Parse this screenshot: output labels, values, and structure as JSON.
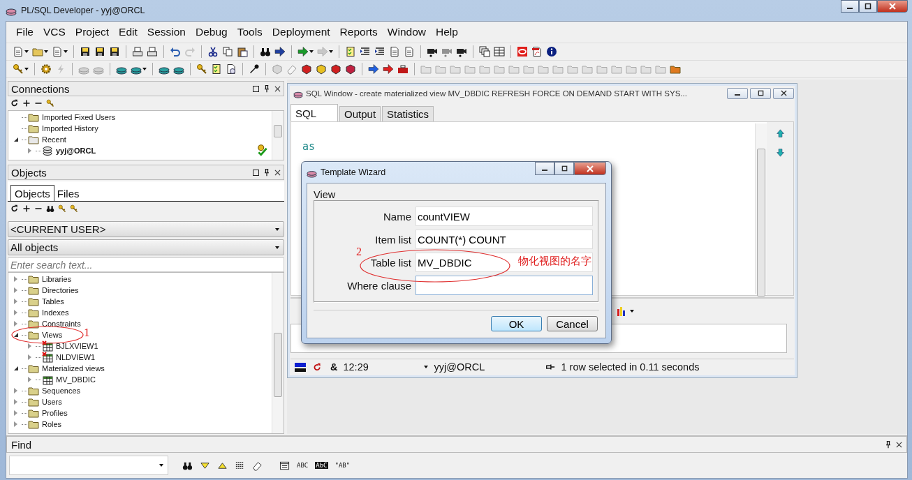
{
  "window": {
    "title": "PL/SQL Developer - yyj@ORCL"
  },
  "menu": [
    "File",
    "VCS",
    "Project",
    "Edit",
    "Session",
    "Debug",
    "Tools",
    "Deployment",
    "Reports",
    "Window",
    "Help"
  ],
  "connections": {
    "title": "Connections",
    "tree": [
      {
        "label": "Imported Fixed Users"
      },
      {
        "label": "Imported History"
      },
      {
        "label": "Recent",
        "expanded": true,
        "children": [
          {
            "label": "yyj@ORCL",
            "current": true
          }
        ]
      }
    ]
  },
  "objects": {
    "title": "Objects",
    "tabs": [
      {
        "label": "Objects",
        "selected": true
      },
      {
        "label": "Files",
        "selected": false
      }
    ],
    "owner": "<CURRENT USER>",
    "filter": "All objects",
    "search": {
      "placeholder": "Enter search text..."
    },
    "tree": [
      {
        "label": "Libraries",
        "expanded": false
      },
      {
        "label": "Directories",
        "expanded": false
      },
      {
        "label": "Tables",
        "expanded": false
      },
      {
        "label": "Indexes",
        "expanded": false
      },
      {
        "label": "Constraints",
        "expanded": false
      },
      {
        "label": "Views",
        "expanded": true,
        "children": [
          {
            "label": "BJLXVIEW1",
            "invalid": true
          },
          {
            "label": "NLDVIEW1",
            "invalid": true
          }
        ]
      },
      {
        "label": "Materialized views",
        "expanded": true,
        "children": [
          {
            "label": "MV_DBDIC",
            "invalid": false
          }
        ]
      },
      {
        "label": "Sequences",
        "expanded": false
      },
      {
        "label": "Users",
        "expanded": false
      },
      {
        "label": "Profiles",
        "expanded": false
      },
      {
        "label": "Roles",
        "expanded": false
      }
    ]
  },
  "sql_window": {
    "title": "SQL Window - create materialized view MV_DBDIC REFRESH FORCE ON DEMAND START WITH SYS...",
    "tabs": [
      {
        "label": "SQL",
        "selected": true
      },
      {
        "label": "Output",
        "selected": false
      },
      {
        "label": "Statistics",
        "selected": false
      }
    ],
    "code": [
      "as"
    ],
    "status": {
      "symbol": "&",
      "time": "12:29",
      "connection": "yyj@ORCL",
      "message": "1 row selected in 0.11 seconds"
    }
  },
  "dialog": {
    "title": "Template Wizard",
    "group": "View",
    "fields": [
      {
        "label": "Name",
        "value": "countVIEW",
        "focused": false
      },
      {
        "label": "Item list",
        "value": "COUNT(*) COUNT",
        "focused": false
      },
      {
        "label": "Table list",
        "value": "MV_DBDIC",
        "focused": false
      },
      {
        "label": "Where clause",
        "focused": true
      }
    ],
    "buttons": [
      {
        "label": "OK",
        "default": true
      },
      {
        "label": "Cancel",
        "default": false
      }
    ]
  },
  "find": {
    "title": "Find",
    "tool_labels": [
      "ABC",
      "AbC",
      "\"AB\""
    ]
  },
  "annotations": [
    {
      "text": "1"
    },
    {
      "text": "2"
    },
    {
      "text": "物化视图的名字"
    }
  ]
}
